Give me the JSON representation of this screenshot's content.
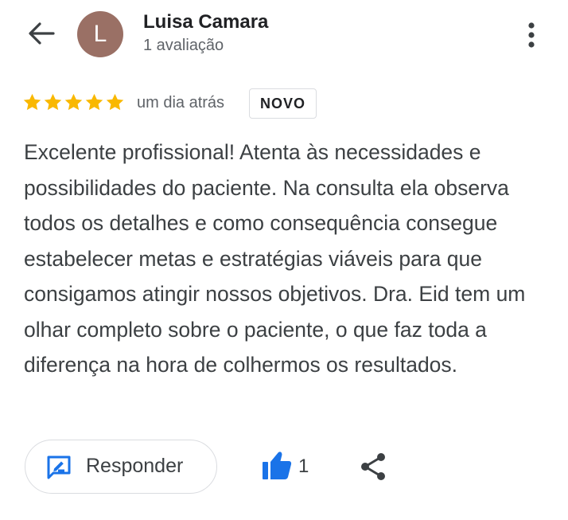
{
  "header": {
    "avatar_initial": "L",
    "user_name": "Luisa Camara",
    "review_count": "1 avaliação"
  },
  "review": {
    "rating": 5,
    "time": "um dia atrás",
    "badge": "NOVO",
    "text": "Excelente profissional! Atenta às necessidades e possibilidades do paciente. Na consulta ela observa todos os detalhes e como consequência consegue estabelecer metas e estratégias viáveis para que consigamos atingir nossos objetivos. Dra. Eid tem um olhar completo sobre o paciente, o que faz toda a diferença na hora de colhermos os resultados."
  },
  "actions": {
    "reply_label": "Responder",
    "like_count": "1"
  },
  "icons": {
    "back": "arrow-back-icon",
    "more": "more-vert-icon",
    "star": "star-icon",
    "reply": "rate-review-icon",
    "like": "thumb-up-icon",
    "share": "share-icon"
  },
  "colors": {
    "avatar_bg": "#9a7065",
    "star": "#f9b800",
    "accent": "#1a73e8",
    "text_primary": "#202124",
    "text_secondary": "#5f6368"
  }
}
